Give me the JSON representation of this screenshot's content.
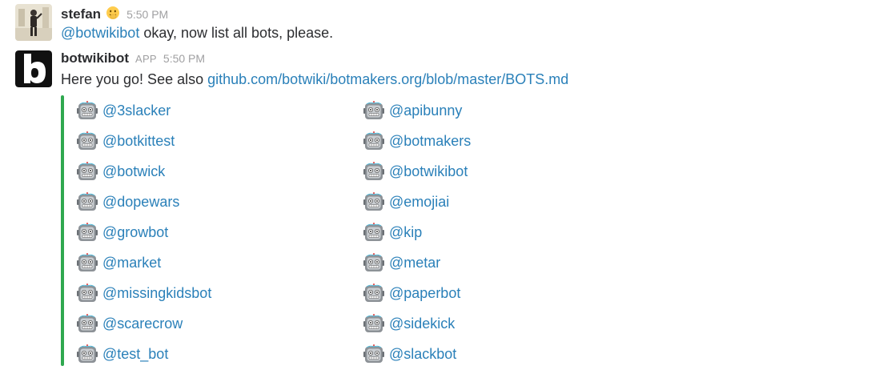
{
  "messages": [
    {
      "sender": "stefan",
      "status_emoji": "face-with-hand-over-mouth-icon",
      "timestamp": "5:50 PM",
      "mention": "@botwikibot",
      "text": " okay, now list all bots, please."
    },
    {
      "sender": "botwikibot",
      "badge": "APP",
      "timestamp": "5:50 PM",
      "text": "Here you go! See also ",
      "link": "github.com/botwiki/botmakers.org/blob/master/BOTS.md",
      "attachment": {
        "accent_color": "#2fa84f",
        "bot_icon": "robot-face-icon",
        "bots": [
          "@3slacker",
          "@apibunny",
          "@botkittest",
          "@botmakers",
          "@botwick",
          "@botwikibot",
          "@dopewars",
          "@emojiai",
          "@growbot",
          "@kip",
          "@market",
          "@metar",
          "@missingkidsbot",
          "@paperbot",
          "@scarecrow",
          "@sidekick",
          "@test_bot",
          "@slackbot"
        ]
      }
    }
  ],
  "colors": {
    "link": "#2a80b9",
    "text": "#2c2d30",
    "muted": "#a0a0a2"
  }
}
